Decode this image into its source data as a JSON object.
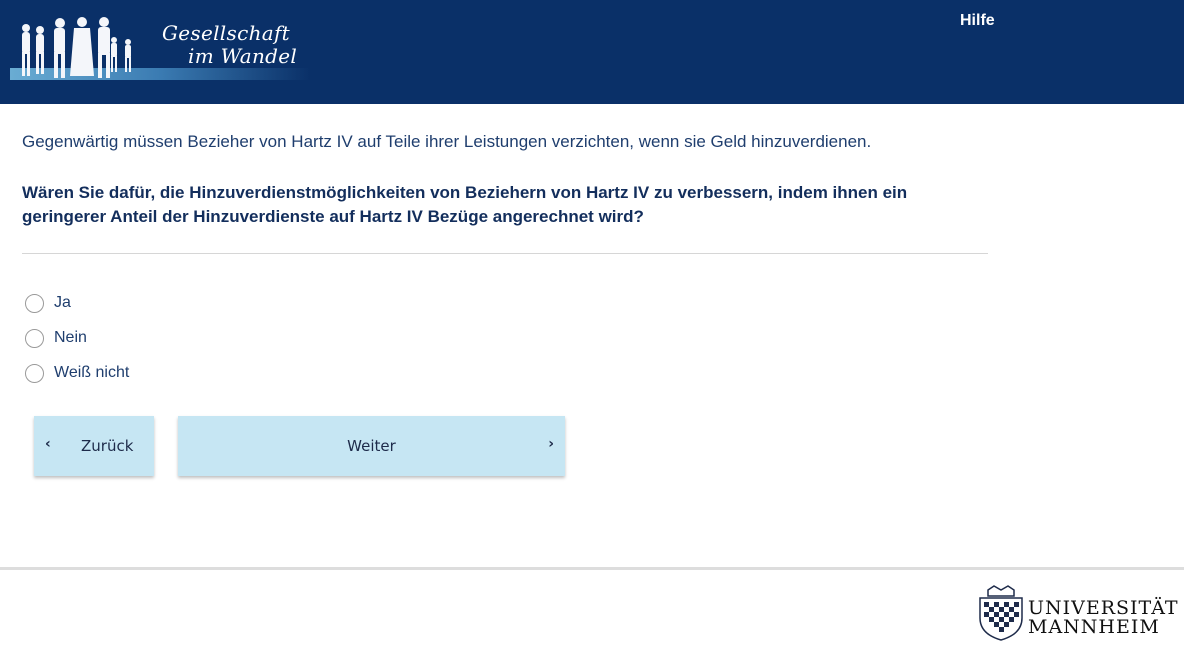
{
  "header": {
    "logo_line1": "Gesellschaft",
    "logo_line2": "im Wandel",
    "help_label": "Hilfe",
    "background_color": "#0a3068"
  },
  "survey": {
    "intro": "Gegenwärtig müssen Bezieher von Hartz IV auf Teile ihrer Leistungen verzichten, wenn sie Geld hinzuverdienen.",
    "question": "Wären Sie dafür, die Hinzuverdienstmöglichkeiten von Beziehern von Hartz IV zu verbessern, indem ihnen ein geringerer Anteil der Hinzuverdienste auf Hartz IV Bezüge angerechnet wird?",
    "options": [
      {
        "label": "Ja",
        "selected": false
      },
      {
        "label": "Nein",
        "selected": false
      },
      {
        "label": "Weiß nicht",
        "selected": false
      }
    ]
  },
  "navigation": {
    "back_label": "Zurück",
    "next_label": "Weiter",
    "back_icon": "chevron-left-icon",
    "next_icon": "chevron-right-icon",
    "button_color": "#c6e6f3"
  },
  "footer": {
    "university_line1": "UNIVERSITÄT",
    "university_line2": "MANNHEIM"
  }
}
